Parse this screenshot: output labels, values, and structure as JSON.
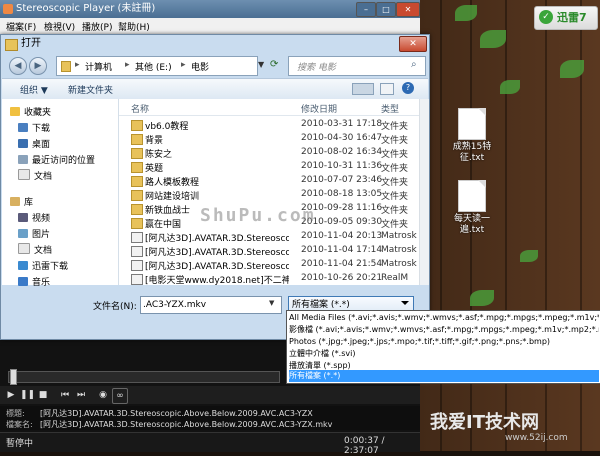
{
  "xunlei": {
    "label": "迅雷7"
  },
  "desktop_icons": [
    {
      "label": "成熟15特征.txt"
    },
    {
      "label": "每天读一遍.txt"
    }
  ],
  "player": {
    "title": "Stereoscopic Player (未註冊)",
    "menu": [
      "檔案(F)",
      "檢視(V)",
      "播放(P)",
      "幫助(H)"
    ],
    "info": {
      "title_label": "標題:",
      "title_value": "[阿凡达3D].AVATAR.3D.Stereoscopic.Above.Below.2009.AVC.AC3-YZX",
      "file_label": "檔案名:",
      "file_value": "[阿凡达3D].AVATAR.3D.Stereoscopic.Above.Below.2009.AVC.AC3-YZX.mkv"
    },
    "status": {
      "state": "暫停中",
      "time": "0:00:37 / 2:37:07"
    }
  },
  "dialog": {
    "title": "打开",
    "breadcrumb": [
      "计算机",
      "其他 (E:)",
      "电影"
    ],
    "search_placeholder": "搜索 电影",
    "toolbar": {
      "organize": "组织 ▼",
      "new_folder": "新建文件夹"
    },
    "sidebar": {
      "favorites": "收藏夹",
      "items": [
        "下载",
        "桌面",
        "最近访问的位置",
        "文档"
      ],
      "library": "库",
      "lib_items": [
        "视频",
        "图片",
        "文档",
        "迅雷下载",
        "音乐"
      ]
    },
    "columns": {
      "name": "名称",
      "date": "修改日期",
      "type": "类型"
    },
    "files": [
      {
        "name": "vb6.0教程",
        "date": "2010-03-31 17:18",
        "type": "文件夹",
        "kind": "folder"
      },
      {
        "name": "背景",
        "date": "2010-04-30 16:47",
        "type": "文件夹",
        "kind": "folder"
      },
      {
        "name": "陈安之",
        "date": "2010-08-02 16:34",
        "type": "文件夹",
        "kind": "folder"
      },
      {
        "name": "英题",
        "date": "2010-10-31 11:36",
        "type": "文件夹",
        "kind": "folder"
      },
      {
        "name": "路人模板教程",
        "date": "2010-07-07 23:46",
        "type": "文件夹",
        "kind": "folder"
      },
      {
        "name": "网站建设培训",
        "date": "2010-08-18 13:05",
        "type": "文件夹",
        "kind": "folder"
      },
      {
        "name": "新铁血战士",
        "date": "2010-09-28 11:16",
        "type": "文件夹",
        "kind": "folder"
      },
      {
        "name": "赢在中国",
        "date": "2010-09-05 09:30",
        "type": "文件夹",
        "kind": "folder"
      },
      {
        "name": "[阿凡达3D].AVATAR.3D.Stereoscopic.A...",
        "date": "2010-11-04 20:13",
        "type": "Matrosk",
        "kind": "video"
      },
      {
        "name": "[阿凡达3D].AVATAR.3D.Stereoscopic.S...",
        "date": "2010-11-04 17:14",
        "type": "Matrosk",
        "kind": "video"
      },
      {
        "name": "[阿凡达3D].AVATAR.3D.Stereoscopic.S...",
        "date": "2010-11-04 21:54",
        "type": "Matrosk",
        "kind": "video"
      },
      {
        "name": "[电影天堂www.dy2018.net]不二神探",
        "date": "2010-10-26 20:21",
        "type": "RealM",
        "kind": "video"
      }
    ],
    "filename_label": "文件名(N):",
    "filename_value": ".AC3-YZX.mkv",
    "filetype_value": "所有檔案 (*.*)",
    "filetype_options": [
      "All Media Files (*.avi;*.avis;*.wmv;*.wmvs;*.asf;*.mpg;*.mpgs;*.mpeg;*.m1v;*.mp2;*.m",
      "影像檔 (*.avi;*.avis;*.wmv;*.wmvs;*.asf;*.mpg;*.mpgs;*.mpeg;*.m1v;*.mp2;*.m2t;*.m2v",
      "Photos (*.jpg;*.jpeg;*.jps;*.mpo;*.tif;*.tiff;*.gif;*.png;*.pns;*.bmp)",
      "立體中介檔 (*.svi)",
      "播放清單 (*.spp)",
      "所有檔案 (*.*)"
    ]
  },
  "watermarks": {
    "mid": "ShuPu.com",
    "br": "我爱IT技术网",
    "br_url": "www.52ij.com"
  }
}
